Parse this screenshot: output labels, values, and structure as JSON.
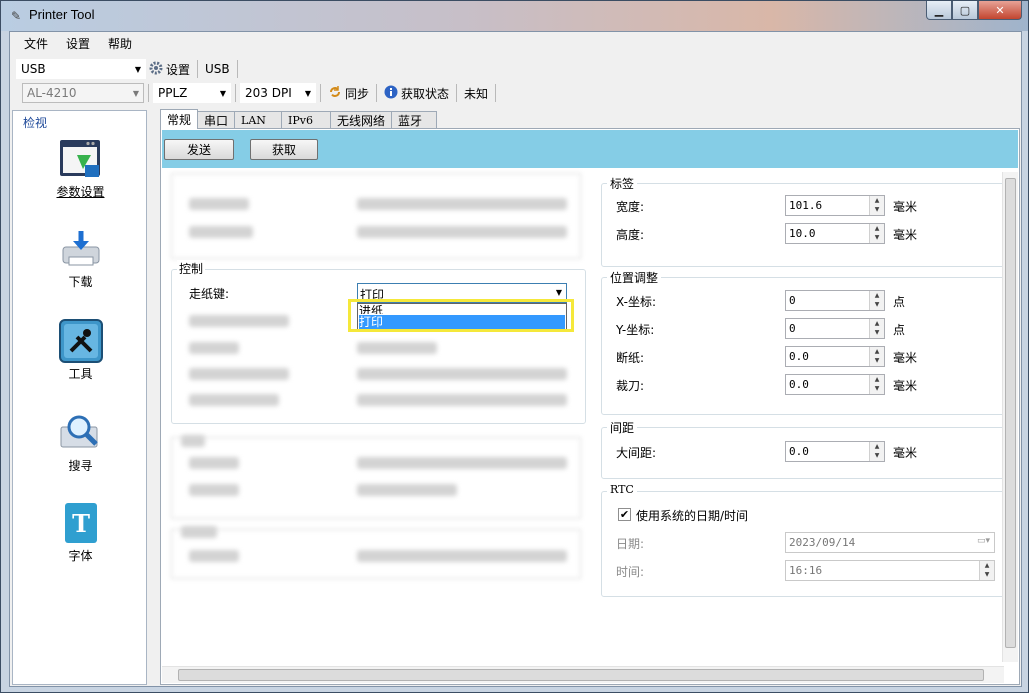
{
  "window": {
    "title": "Printer Tool"
  },
  "menu": [
    "文件",
    "设置",
    "帮助"
  ],
  "toolbar1": {
    "port": "USB",
    "settings_label": "设置",
    "status_port": "USB"
  },
  "toolbar2": {
    "model": "AL-4210",
    "language": "PPLZ",
    "dpi": "203 DPI",
    "sync_label": "同步",
    "get_status_label": "获取状态",
    "status_value": "未知"
  },
  "leftnav": {
    "header": "检视",
    "items": [
      {
        "label": "参数设置",
        "icon": "settings-window-icon"
      },
      {
        "label": "下载",
        "icon": "download-printer-icon"
      },
      {
        "label": "工具",
        "icon": "tools-icon"
      },
      {
        "label": "搜寻",
        "icon": "search-icon"
      },
      {
        "label": "字体",
        "icon": "font-icon"
      }
    ]
  },
  "tabs": [
    "常规",
    "串口",
    "LAN",
    "IPv6",
    "无线网络",
    "蓝牙"
  ],
  "actions": {
    "send": "发送",
    "get": "获取"
  },
  "control": {
    "title": "控制",
    "feed_key_label": "走纸键:",
    "feed_key_value": "打印",
    "options": [
      "进纸",
      "打印"
    ]
  },
  "label_group": {
    "title": "标签",
    "rows": [
      {
        "label": "宽度:",
        "value": "101.6",
        "unit": "毫米"
      },
      {
        "label": "高度:",
        "value": "10.0",
        "unit": "毫米"
      }
    ]
  },
  "position_group": {
    "title": "位置调整",
    "rows": [
      {
        "label": "X-坐标:",
        "value": "0",
        "unit": "点"
      },
      {
        "label": "Y-坐标:",
        "value": "0",
        "unit": "点"
      },
      {
        "label": "断纸:",
        "value": "0.0",
        "unit": "毫米"
      },
      {
        "label": "裁刀:",
        "value": "0.0",
        "unit": "毫米"
      }
    ]
  },
  "gap_group": {
    "title": "间距",
    "rows": [
      {
        "label": "大间距:",
        "value": "0.0",
        "unit": "毫米"
      }
    ]
  },
  "rtc_group": {
    "title": "RTC",
    "use_system_time": "使用系统的日期/时间",
    "date_label": "日期:",
    "date_value": "2023/09/14",
    "time_label": "时间:",
    "time_value": "16:16"
  },
  "colors": {
    "accent_bar": "#85cde6",
    "highlight": "#3399ff",
    "callout": "#f5e83a"
  }
}
